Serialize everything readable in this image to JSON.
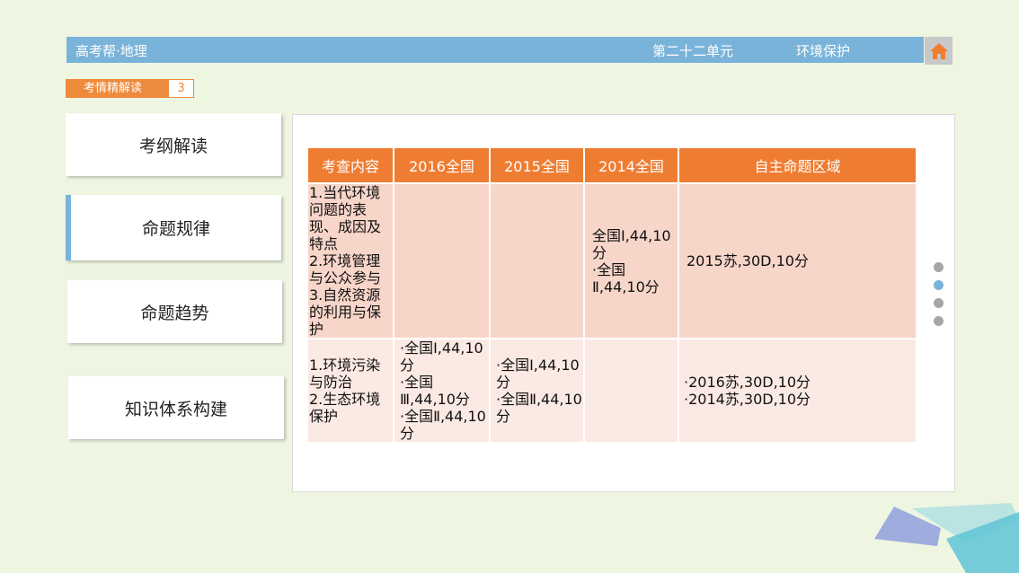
{
  "header": {
    "brand": "高考帮·地理",
    "unit": "第二十二单元",
    "topic": "环境保护"
  },
  "section": {
    "label": "考情精解读",
    "number": "3"
  },
  "nav": [
    {
      "label": "考纲解读"
    },
    {
      "label": "命题规律"
    },
    {
      "label": "命题趋势"
    },
    {
      "label": "知识体系构建"
    }
  ],
  "table": {
    "headers": [
      "考查内容",
      "2016全国",
      "2015全国",
      "2014全国",
      "自主命题区域"
    ],
    "rows": [
      {
        "content": [
          "1.当代环境问题的表现、成因及特点",
          "2.环境管理与公众参与",
          "3.自然资源的利用与保护"
        ],
        "y2016": [],
        "y2015": [],
        "y2014": [
          "全国Ⅰ,44,10分",
          "·全国Ⅱ,44,10分"
        ],
        "region": [
          "2015苏,30D,10分"
        ]
      },
      {
        "content": [
          "1.环境污染与防治",
          "2.生态环境保护"
        ],
        "y2016": [
          "·全国Ⅰ,44,10分",
          "·全国Ⅲ,44,10分",
          "·全国Ⅱ,44,10分"
        ],
        "y2015": [
          "·全国Ⅰ,44,10分",
          "·全国Ⅱ,44,10分"
        ],
        "y2014": [],
        "region": [
          "·2016苏,30D,10分",
          "·2014苏,30D,10分"
        ]
      }
    ]
  },
  "pager": {
    "count": 4,
    "active_index": 1
  },
  "colors": {
    "header_bar": "#7ab3d9",
    "accent_orange": "#ee7d32",
    "row1_bg": "#f7d5c9",
    "row2_bg": "#fbe9e3"
  },
  "icons": {
    "home": "home-icon"
  }
}
